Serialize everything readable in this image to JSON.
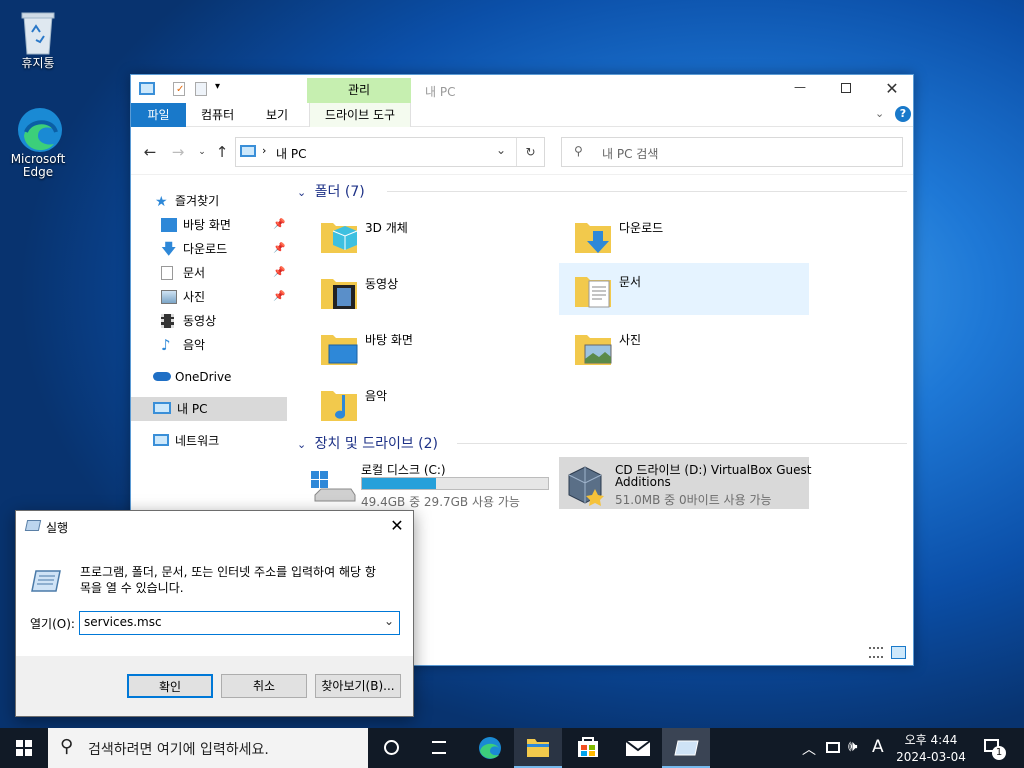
{
  "desktop": {
    "icons": [
      {
        "label": "휴지통"
      },
      {
        "label": "Microsoft Edge"
      }
    ]
  },
  "explorer": {
    "title": "내 PC",
    "contextual_tab": "관리",
    "tabs": [
      "파일",
      "컴퓨터",
      "보기",
      "드라이브 도구"
    ],
    "breadcrumb": "내 PC",
    "search_placeholder": "내 PC 검색",
    "nav": {
      "quick_access": "즐겨찾기",
      "items": [
        "바탕 화면",
        "다운로드",
        "문서",
        "사진",
        "동영상",
        "음악"
      ],
      "onedrive": "OneDrive",
      "this_pc": "내 PC",
      "network": "네트워크"
    },
    "folders_header": "폴더 (7)",
    "folders": [
      "3D 개체",
      "다운로드",
      "동영상",
      "문서",
      "바탕 화면",
      "사진",
      "음악"
    ],
    "devices_header": "장치 및 드라이브 (2)",
    "drives": [
      {
        "name": "로컬 디스크 (C:)",
        "free": "49.4GB 중 29.7GB 사용 가능",
        "used_fraction": 0.4
      },
      {
        "name_line1": "CD 드라이브 (D:) VirtualBox Guest",
        "name_line2": "Additions",
        "free": "51.0MB 중 0바이트 사용 가능"
      }
    ]
  },
  "run_dialog": {
    "title": "실행",
    "description_line1": "프로그램, 폴더, 문서, 또는 인터넷 주소를 입력하여 해당 항",
    "description_line2": "목을 열 수 있습니다.",
    "open_label": "열기(O):",
    "value": "services.msc",
    "ok": "확인",
    "cancel": "취소",
    "browse": "찾아보기(B)..."
  },
  "taskbar": {
    "search_placeholder": "검색하려면 여기에 입력하세요.",
    "ime": "A",
    "time": "오후 4:44",
    "date": "2024-03-04",
    "notification_count": "1"
  },
  "colors": {
    "accent": "#1979ca",
    "ribbon_manage": "#c6efb0",
    "selected": "#e5f3ff",
    "taskbar": "#111a26"
  }
}
